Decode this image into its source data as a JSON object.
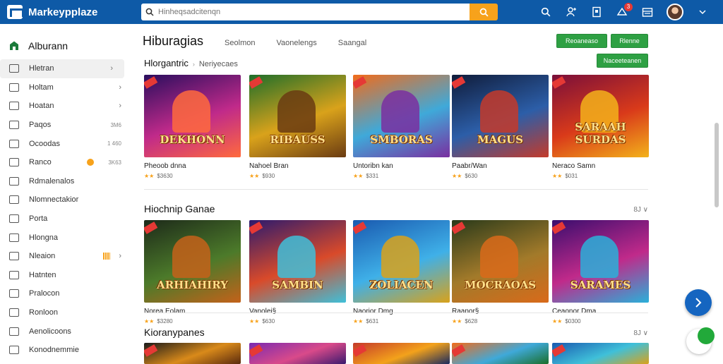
{
  "app": {
    "logo_text": "Markeypplaze",
    "search_placeholder": "Hinheqsadcitenqn",
    "notification_count": "3",
    "colors": {
      "brand": "#0e5aa7",
      "accent": "#f7a21b",
      "primary_button": "#2ea043"
    }
  },
  "sidebar": {
    "heading": "Alburann",
    "items": [
      {
        "label": "Hletran",
        "meta": "",
        "chevron": "›"
      },
      {
        "label": "Holtam",
        "meta": "",
        "chevron": "›"
      },
      {
        "label": "Hoatan",
        "meta": "",
        "chevron": "›"
      },
      {
        "label": "Paqos",
        "meta": "3M6",
        "chevron": ""
      },
      {
        "label": "Ocoodas",
        "meta": "1 460",
        "chevron": ""
      },
      {
        "label": "Ranco",
        "meta": "3K63",
        "chevron": ""
      },
      {
        "label": "Rdmalenalos",
        "meta": "",
        "chevron": ""
      },
      {
        "label": "Nlomnectakior",
        "meta": "",
        "chevron": ""
      },
      {
        "label": "Porta",
        "meta": "",
        "chevron": ""
      },
      {
        "label": "Hlongna",
        "meta": "",
        "chevron": ""
      },
      {
        "label": "Nleaion",
        "meta": "",
        "chevron": "›"
      },
      {
        "label": "Hatnten",
        "meta": "",
        "chevron": ""
      },
      {
        "label": "Pralocon",
        "meta": "",
        "chevron": ""
      },
      {
        "label": "Ronloon",
        "meta": "",
        "chevron": ""
      },
      {
        "label": "Aenolicoons",
        "meta": "",
        "chevron": ""
      },
      {
        "label": "Konodnemmie",
        "meta": "",
        "chevron": ""
      }
    ]
  },
  "main": {
    "title": "Hiburagias",
    "tabs": [
      "Seolmon",
      "Vaonelengs",
      "Saangal"
    ],
    "buttons": [
      "Reoaneaso",
      "Rlenne",
      "Naceeteanen"
    ],
    "subtitle": "Hlorgantric",
    "subtitle_small": "Neriyecaes",
    "sections": [
      {
        "title": "",
        "control": "",
        "cards": [
          {
            "game": "DEKHONN",
            "name": "Pheoob dnna",
            "rating": "$3630"
          },
          {
            "game": "RIBAUSS",
            "name": "Nahoel Bran",
            "rating": "$930"
          },
          {
            "game": "SMBORAS",
            "name": "Untoribn kan",
            "rating": "$331"
          },
          {
            "game": "MAGUS",
            "name": "Paabr/Wan",
            "rating": "$630"
          },
          {
            "game": "SARAAH SURDAS",
            "name": "Neraco Samn",
            "rating": "$031"
          }
        ]
      },
      {
        "title": "Hiochnip Ganae",
        "control": "8J",
        "cards": [
          {
            "game": "ARHIAHIRY",
            "name": "Norea Eolam",
            "rating": "$3280"
          },
          {
            "game": "SAMBIN",
            "name": "Vanolei§",
            "rating": "$630"
          },
          {
            "game": "ZOLIACEN",
            "name": "Naorior Dmg",
            "rating": "$631"
          },
          {
            "game": "MOCRAOAS",
            "name": "Raanor§",
            "rating": "$628"
          },
          {
            "game": "SARAMES",
            "name": "Ceaonor Dma",
            "rating": "$0300"
          }
        ]
      },
      {
        "title": "Kioranypanes",
        "control": "8J",
        "cards": [
          {
            "game": "",
            "name": "",
            "rating": ""
          },
          {
            "game": "",
            "name": "",
            "rating": ""
          },
          {
            "game": "",
            "name": "",
            "rating": ""
          },
          {
            "game": "",
            "name": "",
            "rating": ""
          },
          {
            "game": "",
            "name": "",
            "rating": ""
          }
        ]
      }
    ]
  }
}
